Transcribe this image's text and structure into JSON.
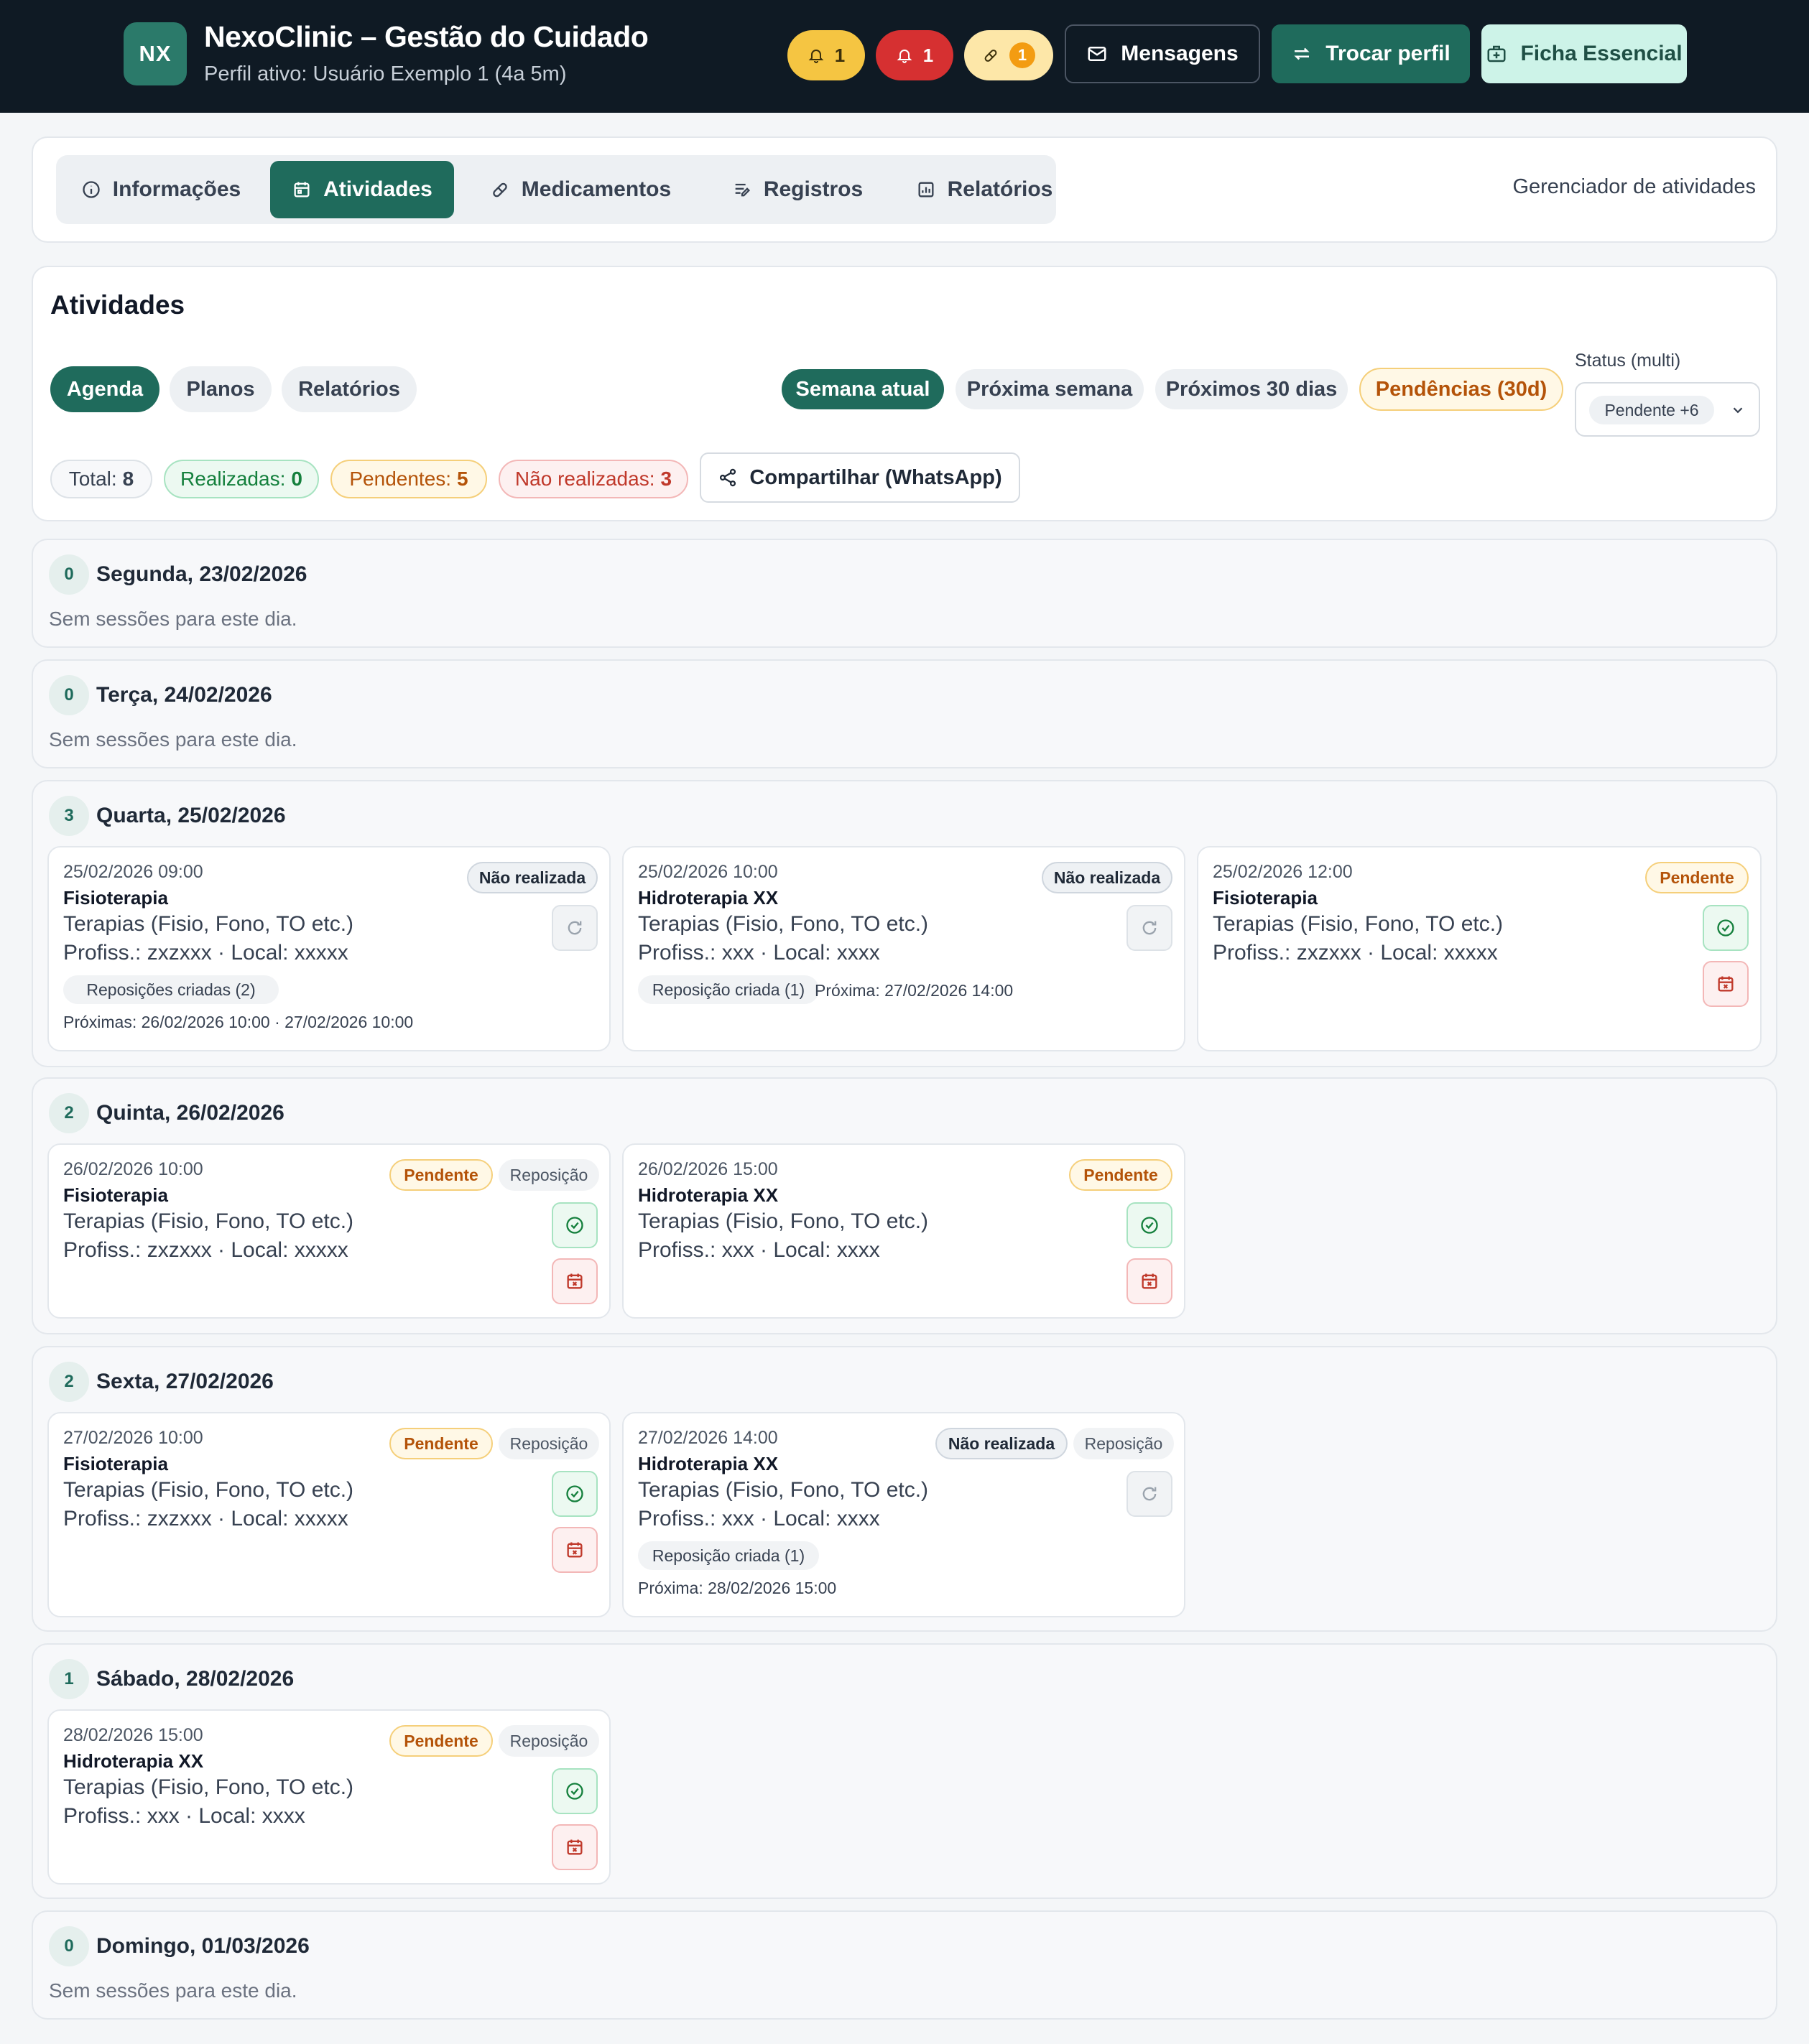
{
  "header": {
    "logo_initials": "NX",
    "app_title": "NexoClinic – Gestão do Cuidado",
    "active_profile": "Perfil ativo: Usuário Exemplo 1 (4a 5m)",
    "alerts": [
      {
        "icon": "bell-icon",
        "count": "1",
        "color": "#f5c542"
      },
      {
        "icon": "bell-icon",
        "count": "1",
        "color": "#d63031"
      },
      {
        "icon": "pill-icon",
        "count": "1",
        "color": "#fde7a8"
      }
    ],
    "messages_label": "Mensagens",
    "switch_profile_label": "Trocar perfil",
    "essential_sheet_label": "Ficha Essencial"
  },
  "nav": {
    "tabs": [
      {
        "label": "Informações",
        "icon": "info-icon",
        "active": false
      },
      {
        "label": "Atividades",
        "icon": "calendar-icon",
        "active": true
      },
      {
        "label": "Medicamentos",
        "icon": "pill-icon",
        "active": false
      },
      {
        "label": "Registros",
        "icon": "notes-icon",
        "active": false
      },
      {
        "label": "Relatórios",
        "icon": "report-icon",
        "active": false
      }
    ],
    "right_label": "Gerenciador de atividades"
  },
  "activities": {
    "title": "Atividades",
    "subtabs": [
      "Agenda",
      "Planos",
      "Relatórios"
    ],
    "periods": [
      "Semana atual",
      "Próxima semana",
      "Próximos 30 dias",
      "Pendências (30d)"
    ],
    "status_label": "Status (multi)",
    "status_value": "Pendente +6",
    "stats": {
      "total_label": "Total:",
      "total": "8",
      "done_label": "Realizadas:",
      "done": "0",
      "pending_label": "Pendentes:",
      "pending": "5",
      "missed_label": "Não realizadas:",
      "missed": "3"
    },
    "share_label": "Compartilhar (WhatsApp)"
  },
  "empty_text": "Sem sessões para este dia.",
  "days": [
    {
      "count": "0",
      "title": "Segunda, 23/02/2026"
    },
    {
      "count": "0",
      "title": "Terça, 24/02/2026"
    },
    {
      "count": "3",
      "title": "Quarta, 25/02/2026"
    },
    {
      "count": "2",
      "title": "Quinta, 26/02/2026"
    },
    {
      "count": "2",
      "title": "Sexta, 27/02/2026"
    },
    {
      "count": "1",
      "title": "Sábado, 28/02/2026"
    },
    {
      "count": "0",
      "title": "Domingo, 01/03/2026"
    }
  ],
  "sessions": [
    {
      "datetime": "25/02/2026 09:00",
      "title": "Fisioterapia",
      "category": "Terapias (Fisio, Fono, TO etc.)",
      "professional": "Profiss.: zxzxxx · Local: xxxxx",
      "status": "Não realizada",
      "chip": "Reposições criadas (2)",
      "next": "Próximas: 26/02/2026 10:00 · 27/02/2026 10:00"
    },
    {
      "datetime": "25/02/2026 10:00",
      "title": "Hidroterapia XX",
      "category": "Terapias (Fisio, Fono, TO etc.)",
      "professional": "Profiss.: xxx · Local: xxxx",
      "status": "Não realizada",
      "chip": "Reposição criada (1)",
      "next": "Próxima: 27/02/2026 14:00"
    },
    {
      "datetime": "25/02/2026 12:00",
      "title": "Fisioterapia",
      "category": "Terapias (Fisio, Fono, TO etc.)",
      "professional": "Profiss.: zxzxxx · Local: xxxxx",
      "status": "Pendente"
    },
    {
      "datetime": "26/02/2026 10:00",
      "title": "Fisioterapia",
      "category": "Terapias (Fisio, Fono, TO etc.)",
      "professional": "Profiss.: zxzxxx · Local: xxxxx",
      "status": "Pendente",
      "tag": "Reposição"
    },
    {
      "datetime": "26/02/2026 15:00",
      "title": "Hidroterapia XX",
      "category": "Terapias (Fisio, Fono, TO etc.)",
      "professional": "Profiss.: xxx · Local: xxxx",
      "status": "Pendente"
    },
    {
      "datetime": "27/02/2026 10:00",
      "title": "Fisioterapia",
      "category": "Terapias (Fisio, Fono, TO etc.)",
      "professional": "Profiss.: zxzxxx · Local: xxxxx",
      "status": "Pendente",
      "tag": "Reposição"
    },
    {
      "datetime": "27/02/2026 14:00",
      "title": "Hidroterapia XX",
      "category": "Terapias (Fisio, Fono, TO etc.)",
      "professional": "Profiss.: xxx · Local: xxxx",
      "status": "Não realizada",
      "tag": "Reposição",
      "chip": "Reposição criada (1)",
      "next": "Próxima: 28/02/2026 15:00"
    },
    {
      "datetime": "28/02/2026 15:00",
      "title": "Hidroterapia XX",
      "category": "Terapias (Fisio, Fono, TO etc.)",
      "professional": "Profiss.: xxx · Local: xxxx",
      "status": "Pendente",
      "tag": "Reposição"
    }
  ]
}
